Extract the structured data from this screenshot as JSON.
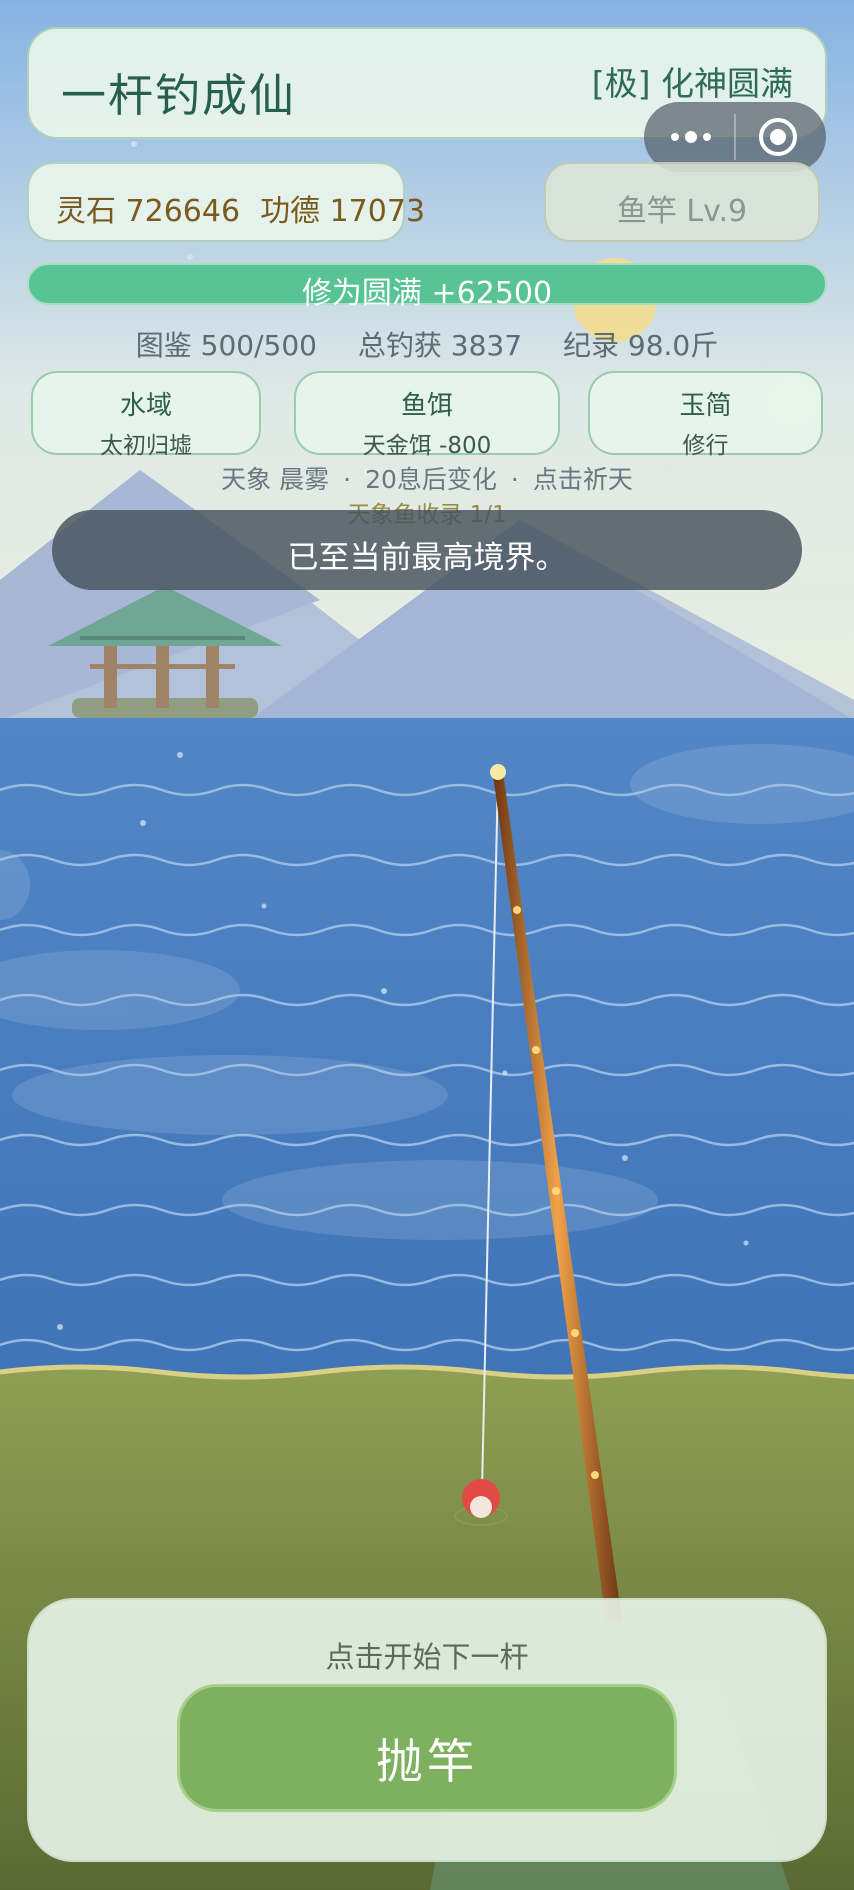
{
  "header": {
    "title": "一杆钓成仙",
    "realm": "[极] 化神圆满"
  },
  "resources": {
    "spirit_stones": "灵石 726646",
    "merit": "功德 17073"
  },
  "rod_button": "鱼竿 Lv.9",
  "cultivation_bar": {
    "label": "修为圆满 +62500",
    "progress": 1.0
  },
  "stats": {
    "collection": "图鉴 500/500",
    "total_catch": "总钓获 3837",
    "record": "纪录 98.0斤"
  },
  "selectors": [
    {
      "title": "水域",
      "value": "太初归墟"
    },
    {
      "title": "鱼饵",
      "value": "天金饵 -800"
    },
    {
      "title": "玉简",
      "value": "修行"
    }
  ],
  "weather": {
    "condition": "天象 晨雾",
    "countdown": "20息后变化",
    "pray": "点击祈天",
    "separator": "·"
  },
  "weather_collection": "天象鱼收录 1/1",
  "toast": "已至当前最高境界。",
  "bottom": {
    "hint": "点击开始下一杆",
    "cast_button": "抛竿"
  },
  "icons": [
    "more-dots-icon",
    "target-circle-icon",
    "sparkle-icon"
  ],
  "colors": {
    "sky_top": "#86b2e3",
    "water": "#4a80c0",
    "grass": "#8a9a4c",
    "accent_green": "#58c496",
    "button_green": "#7db160"
  }
}
